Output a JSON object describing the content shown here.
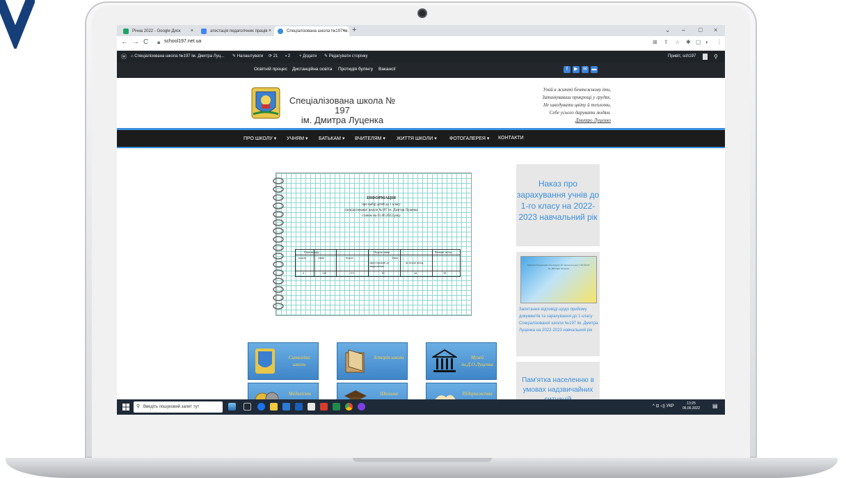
{
  "browser": {
    "tabs": [
      {
        "label": "Річна 2022 - Google Диск",
        "close": "×",
        "color": "#1fa463"
      },
      {
        "label": "атестація педагогічних праців",
        "close": "×",
        "color": "#4285f4"
      },
      {
        "label": "Спеціалізована школа №197 ім.",
        "close": "×",
        "color": "#3a8edc"
      }
    ],
    "new_tab": "+",
    "window_controls": [
      "⌄",
      "–",
      "□",
      "×"
    ],
    "url": "school197.net.ua"
  },
  "wp_admin_bar": {
    "items": [
      "Спеціалізована школа №197 ім. Дмитра Луц...",
      "Налаштувати",
      "21",
      "2",
      "+ Додати",
      "Редагувати сторінку"
    ],
    "greeting": "Привіт, sch197"
  },
  "top_nav": {
    "items": [
      "Освітній процес",
      "Дистанційна освіта",
      "Протидія булінгу",
      "Вакансії"
    ],
    "social": [
      "f",
      "▶",
      "✉",
      "▬"
    ]
  },
  "header": {
    "site_name_line1": "Спеціалізована школа № 197",
    "site_name_line2": "ім. Дмитра Луценка",
    "poem": [
      "Умій в житті бентежному іти,",
      "Затамувавши прикрощі у грудях,",
      "Не шкодувати цвіту й теплоти,",
      "Себе усього дарувати людям.",
      "Дмитро Луценко"
    ]
  },
  "main_nav": {
    "items": [
      "ПРО ШКОЛУ ▾",
      "УЧНЯМ ▾",
      "БАТЬКАМ ▾",
      "ВЧИТЕЛЯМ ▾",
      "ЖИТТЯ ШКОЛИ ▾",
      "ФОТОГАЛЕРЕЯ ▾",
      "КОНТАКТИ"
    ]
  },
  "notebook": {
    "title": "ІНФОРМАЦІЯ",
    "lines": [
      "про набір дітей до 1 класу",
      "спеціалізованої школи №197 ім. Дмитра Луценка",
      "станом на 01.06.2022 року"
    ],
    "table": {
      "headers": [
        "План набору",
        "Подали заяви",
        "Вільних місць"
      ],
      "subheaders": [
        "класів",
        "учнів",
        "всього",
        "З них",
        "зареєстровані до закріплення",
        "на вільні місця"
      ],
      "values": [
        "4",
        "120",
        "115",
        "81",
        "44",
        "39"
      ]
    }
  },
  "sidebar": {
    "box1": "Наказ про зарахування учнів до 1-го класу на 2022-2023 навчальний рік",
    "box2_image_text": "Прийом документів для вступу до першого класу СШ №197 ім. Дмитра Луценка",
    "box2_text": "Запитання-відповіді щодо прийому документів та зарахування до 1 класу Спеціалізованої школи №197 ім. Дмитра Луценка на 2022-2023 навчальний рік",
    "box3": "Пам'ятка населенню в умовах надзвичайних ситуацій"
  },
  "tiles": [
    {
      "label": "Символіка школи"
    },
    {
      "label": "Історія школи"
    },
    {
      "label": "Музей ім.Д.О.Луценка"
    },
    {
      "label": "Медалісти"
    },
    {
      "label": "Шкільна"
    },
    {
      "label": "Підприємства"
    }
  ],
  "taskbar": {
    "search_placeholder": "Введіть пошуковий запит тут",
    "tray": "^ ⊡ ◁) УКР",
    "time": "13:25",
    "date": "06.06.2022"
  }
}
